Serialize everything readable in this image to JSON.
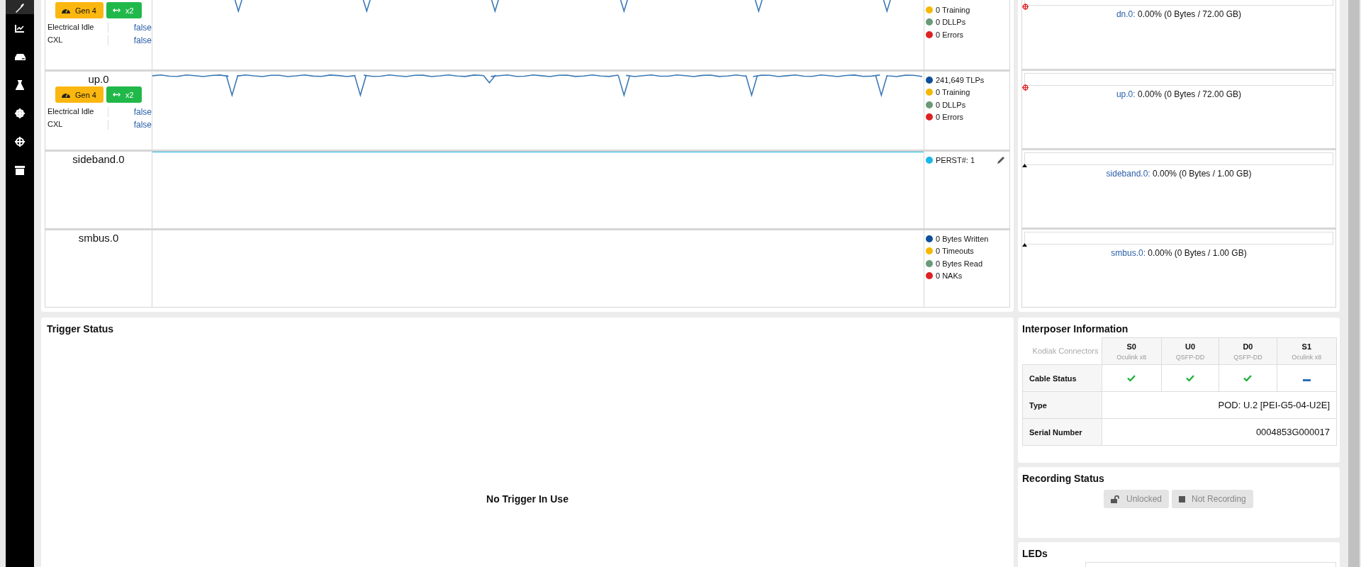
{
  "sidebar": {
    "items": [
      {
        "selected": true
      },
      {
        "selected": false
      },
      {
        "selected": false
      },
      {
        "selected": false
      },
      {
        "selected": false
      },
      {
        "selected": false
      },
      {
        "selected": false
      }
    ]
  },
  "lanes": [
    {
      "kind": "cut",
      "speed": "Gen 4",
      "width": "x2",
      "props": [
        {
          "label": "Electrical Idle",
          "value": "false"
        },
        {
          "label": "CXL",
          "value": "false"
        }
      ],
      "legend": [
        {
          "text": "0 Training",
          "color": "#f5b800"
        },
        {
          "text": "0 DLLPs",
          "color": "#6a9a78"
        },
        {
          "text": "0 Errors",
          "color": "#dd2222"
        }
      ],
      "editable": false
    },
    {
      "name": "up.0",
      "kind": "pcie",
      "speed": "Gen 4",
      "width": "x2",
      "props": [
        {
          "label": "Electrical Idle",
          "value": "false"
        },
        {
          "label": "CXL",
          "value": "false"
        }
      ],
      "legend": [
        {
          "text": "241,649 TLPs",
          "color": "#0d4f9a"
        },
        {
          "text": "0 Training",
          "color": "#f5b800"
        },
        {
          "text": "0 DLLPs",
          "color": "#6a9a78"
        },
        {
          "text": "0 Errors",
          "color": "#dd2222"
        }
      ],
      "editable": false
    },
    {
      "name": "sideband.0",
      "kind": "signal",
      "legend": [
        {
          "text": "PERST#: 1",
          "color": "#1ab8e8"
        }
      ],
      "editable": true
    },
    {
      "name": "smbus.0",
      "kind": "bus",
      "legend": [
        {
          "text": "0 Bytes Written",
          "color": "#0d4f9a"
        },
        {
          "text": "0 Timeouts",
          "color": "#f5b800"
        },
        {
          "text": "0 Bytes Read",
          "color": "#6a9a78"
        },
        {
          "text": "0 NAKs",
          "color": "#dd2222"
        }
      ],
      "editable": false
    }
  ],
  "buffers": [
    {
      "kind": "pcie",
      "name": "dn.0:",
      "usage": "0.00% (0 Bytes / 72.00 GB)",
      "level": 0
    },
    {
      "kind": "pcie",
      "name": "up.0:",
      "usage": "0.00% (0 Bytes / 72.00 GB)",
      "level": 0
    },
    {
      "kind": "sideband",
      "name": "sideband.0:",
      "usage": "0.00% (0 Bytes / 1.00 GB)",
      "level": 0
    },
    {
      "kind": "sideband",
      "name": "smbus.0:",
      "usage": "0.00% (0 Bytes / 1.00 GB)",
      "level": 0
    }
  ],
  "trigger": {
    "title": "Trigger Status",
    "message": "No Trigger In Use"
  },
  "interposer": {
    "title": "Interposer Information",
    "corner": "Kodiak Connectors",
    "connectors": [
      {
        "name": "S0",
        "type": "Oculink x8",
        "kind": "connected"
      },
      {
        "name": "U0",
        "type": "QSFP-DD",
        "kind": "connected"
      },
      {
        "name": "D0",
        "type": "QSFP-DD",
        "kind": "connected"
      },
      {
        "name": "S1",
        "type": "Oculink x8",
        "kind": "absent"
      }
    ],
    "cable_label": "Cable Status",
    "rows": [
      {
        "label": "Type",
        "value": "POD: U.2 [PEI-G5-04-U2E]"
      },
      {
        "label": "Serial Number",
        "value": "0004853G000017"
      }
    ]
  },
  "recording": {
    "title": "Recording Status",
    "buttons": [
      {
        "kind": "lock",
        "label": "Unlocked"
      },
      {
        "kind": "stop",
        "label": "Not Recording"
      }
    ]
  },
  "leds": {
    "title": "LEDs"
  }
}
